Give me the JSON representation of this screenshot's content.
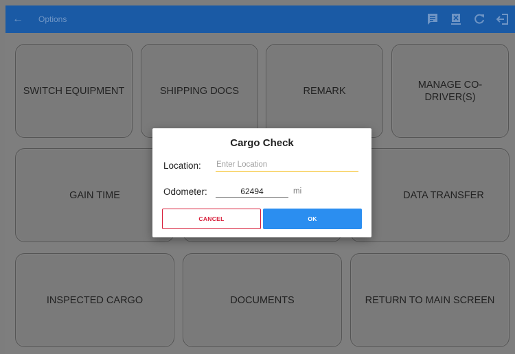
{
  "header": {
    "back_glyph": "←",
    "title": "Options",
    "icons": [
      "message-icon",
      "export-icon",
      "refresh-icon",
      "logout-icon"
    ]
  },
  "tiles": {
    "switch_equipment": "SWITCH EQUIPMENT",
    "shipping_docs": "SHIPPING DOCS",
    "remark": "REMARK",
    "manage_codriver": "MANAGE CO-DRIVER(S)",
    "gain_time": "GAIN TIME",
    "data_transfer": "DATA TRANSFER",
    "inspected_cargo": "INSPECTED CARGO",
    "documents": "DOCUMENTS",
    "return_main": "RETURN TO MAIN SCREEN"
  },
  "dialog": {
    "title": "Cargo Check",
    "location_label": "Location:",
    "location_placeholder": "Enter Location",
    "location_value": "",
    "odometer_label": "Odometer:",
    "odometer_value": "62494",
    "odometer_unit": "mi",
    "cancel_label": "CANCEL",
    "ok_label": "OK"
  },
  "colors": {
    "topbar": "#1a5aa5",
    "cancel": "#d81e3a",
    "ok": "#2b8ef0",
    "input_accent": "#f3b500"
  }
}
